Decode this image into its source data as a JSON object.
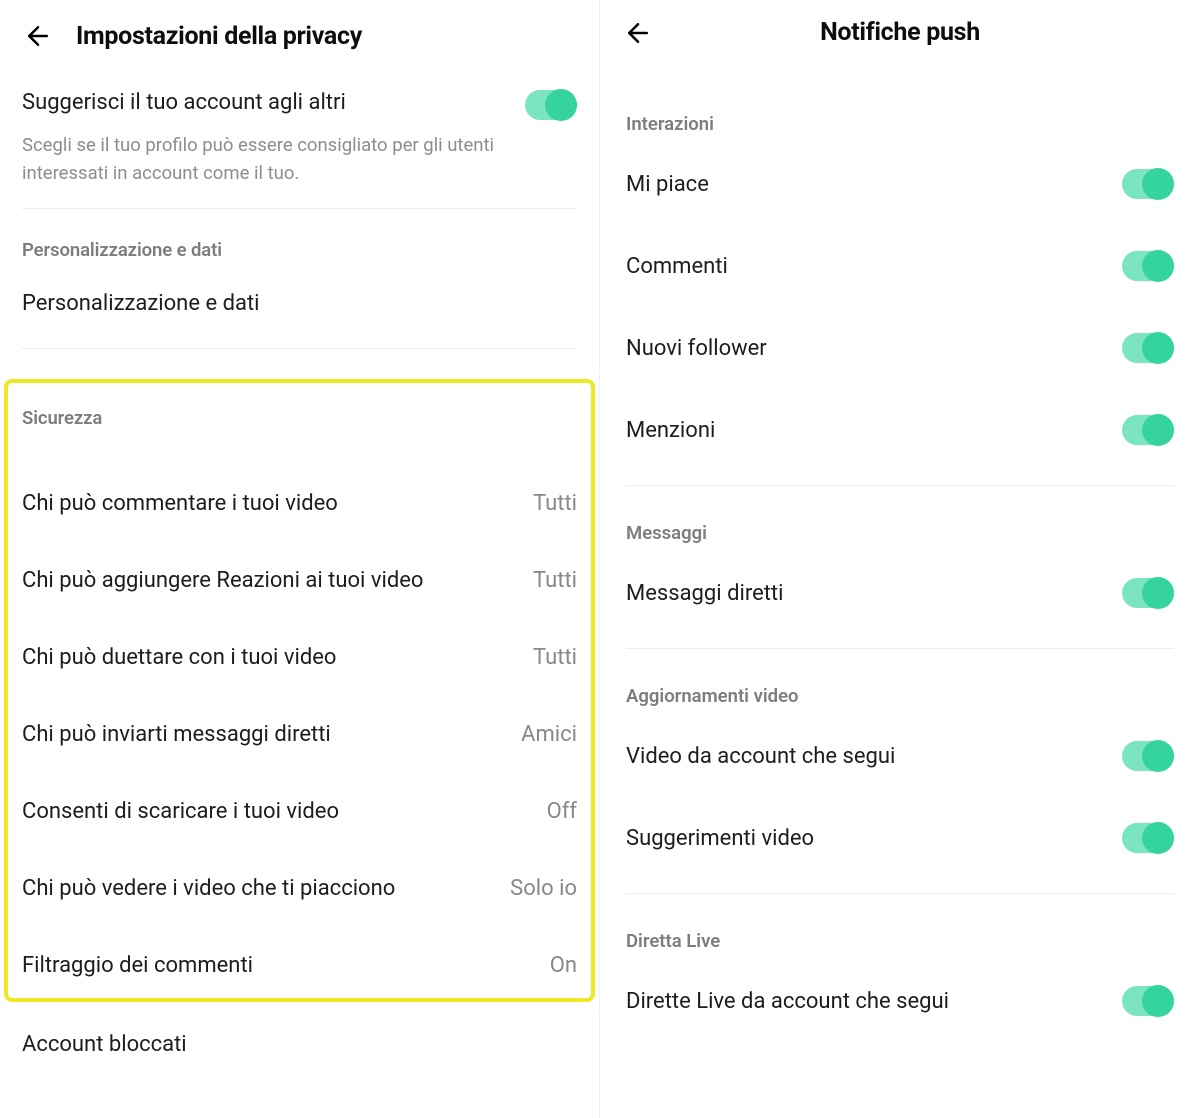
{
  "left": {
    "title": "Impostazioni della privacy",
    "suggest": {
      "label": "Suggerisci il tuo account agli altri",
      "desc": "Scegli se il tuo profilo può essere consigliato per gli utenti interessati in account come il tuo."
    },
    "personalization": {
      "header": "Personalizzazione e dati",
      "item": "Personalizzazione e dati"
    },
    "security": {
      "header": "Sicurezza",
      "options": [
        {
          "label": "Chi può commentare i tuoi video",
          "value": "Tutti"
        },
        {
          "label": "Chi può aggiungere Reazioni ai tuoi video",
          "value": "Tutti"
        },
        {
          "label": "Chi può duettare con i tuoi video",
          "value": "Tutti"
        },
        {
          "label": "Chi può inviarti messaggi diretti",
          "value": "Amici"
        },
        {
          "label": "Consenti di scaricare i tuoi video",
          "value": "Off"
        },
        {
          "label": "Chi può vedere i video che ti piacciono",
          "value": "Solo io"
        },
        {
          "label": "Filtraggio dei commenti",
          "value": "On"
        }
      ]
    },
    "blocked": "Account bloccati"
  },
  "right": {
    "title": "Notifiche push",
    "groups": [
      {
        "header": "Interazioni",
        "items": [
          {
            "label": "Mi piace"
          },
          {
            "label": "Commenti"
          },
          {
            "label": "Nuovi follower"
          },
          {
            "label": "Menzioni"
          }
        ]
      },
      {
        "header": "Messaggi",
        "items": [
          {
            "label": "Messaggi diretti"
          }
        ]
      },
      {
        "header": "Aggiornamenti video",
        "items": [
          {
            "label": "Video da account che segui"
          },
          {
            "label": "Suggerimenti video"
          }
        ]
      },
      {
        "header": "Diretta Live",
        "items": [
          {
            "label": "Dirette Live da account che segui"
          }
        ]
      }
    ]
  }
}
